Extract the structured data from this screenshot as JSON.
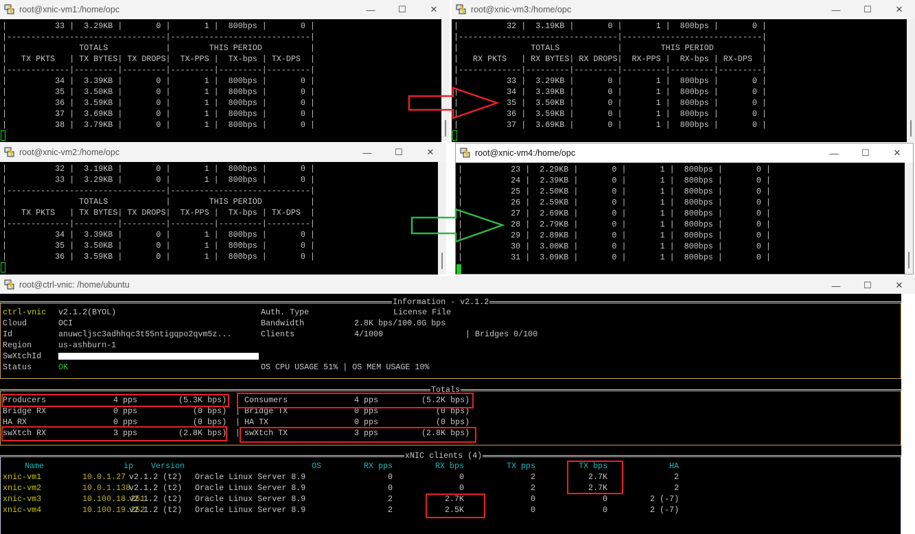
{
  "windows": {
    "vm1": {
      "title": "root@xnic-vm1:/home/opc",
      "prefix": "TX",
      "period_prefix": "TX",
      "top_rows": [
        [
          "33",
          "3.29KB",
          "0",
          "1",
          "800bps",
          "0"
        ]
      ],
      "rows": [
        [
          "34",
          "3.39KB",
          "0",
          "1",
          "800bps",
          "0"
        ],
        [
          "35",
          "3.50KB",
          "0",
          "1",
          "800bps",
          "0"
        ],
        [
          "36",
          "3.59KB",
          "0",
          "1",
          "800bps",
          "0"
        ],
        [
          "37",
          "3.69KB",
          "0",
          "1",
          "800bps",
          "0"
        ],
        [
          "38",
          "3.79KB",
          "0",
          "1",
          "800bps",
          "0"
        ]
      ]
    },
    "vm3": {
      "title": "root@xnic-vm3:/home/opc",
      "prefix": "RX",
      "period_prefix": "RX",
      "top_rows": [
        [
          "32",
          "3.19KB",
          "0",
          "1",
          "800bps",
          "0"
        ]
      ],
      "rows": [
        [
          "33",
          "3.29KB",
          "0",
          "1",
          "800bps",
          "0"
        ],
        [
          "34",
          "3.39KB",
          "0",
          "1",
          "800bps",
          "0"
        ],
        [
          "35",
          "3.50KB",
          "0",
          "1",
          "800bps",
          "0"
        ],
        [
          "36",
          "3.59KB",
          "0",
          "1",
          "800bps",
          "0"
        ],
        [
          "37",
          "3.69KB",
          "0",
          "1",
          "800bps",
          "0"
        ]
      ]
    },
    "vm2": {
      "title": "root@xnic-vm2:/home/opc",
      "prefix": "TX",
      "period_prefix": "TX",
      "top_rows": [
        [
          "32",
          "3.19KB",
          "0",
          "1",
          "800bps",
          "0"
        ],
        [
          "33",
          "3.29KB",
          "0",
          "1",
          "800bps",
          "0"
        ]
      ],
      "rows": [
        [
          "34",
          "3.39KB",
          "0",
          "1",
          "800bps",
          "0"
        ],
        [
          "35",
          "3.50KB",
          "0",
          "1",
          "800bps",
          "0"
        ],
        [
          "36",
          "3.59KB",
          "0",
          "1",
          "800bps",
          "0"
        ]
      ]
    },
    "vm4": {
      "title": "root@xnic-vm4:/home/opc",
      "rows": [
        [
          "23",
          "2.29KB",
          "0",
          "1",
          "800bps",
          "0"
        ],
        [
          "24",
          "2.39KB",
          "0",
          "1",
          "800bps",
          "0"
        ],
        [
          "25",
          "2.50KB",
          "0",
          "1",
          "800bps",
          "0"
        ],
        [
          "26",
          "2.59KB",
          "0",
          "1",
          "800bps",
          "0"
        ],
        [
          "27",
          "2.69KB",
          "0",
          "1",
          "800bps",
          "0"
        ],
        [
          "28",
          "2.79KB",
          "0",
          "1",
          "800bps",
          "0"
        ],
        [
          "29",
          "2.89KB",
          "0",
          "1",
          "800bps",
          "0"
        ],
        [
          "30",
          "3.00KB",
          "0",
          "1",
          "800bps",
          "0"
        ],
        [
          "31",
          "3.09KB",
          "0",
          "1",
          "800bps",
          "0"
        ]
      ]
    },
    "headings": {
      "totals": "TOTALS",
      "period": "THIS PERIOD",
      "pkts": "PKTS",
      "bytes": "BYTES",
      "drops": "DROPS",
      "pps": "-PPS",
      "bps": "-bps",
      "dps": "-DPS"
    }
  },
  "ctrl": {
    "title": "root@ctrl-vnic: /home/ubuntu",
    "info": {
      "box_title": "Information - v2.1.2",
      "product": "ctrl-vnic",
      "version": "v2.1.2(BYOL)",
      "cloud_label": "Cloud",
      "cloud": "OCI",
      "id_label": "Id",
      "id": "anuwcljsc3adhhqc3t55ntigqpo2qvm5z...",
      "region_label": "Region",
      "region": "us-ashburn-1",
      "swxtchid_label": "SwXtchId",
      "status_label": "Status",
      "status": "OK",
      "auth_label": "Auth. Type",
      "auth": "License File",
      "bandwidth_label": "Bandwidth",
      "bandwidth": "2.8K bps/100.0G bps",
      "clients_label": "Clients",
      "clients": "4/1000",
      "bridges": "| Bridges 0/100",
      "usage": "OS CPU USAGE 51% | OS MEM USAGE 10%"
    },
    "totals": {
      "box_title": "Totals",
      "left": [
        {
          "label": "Producers",
          "pps": "4 pps",
          "bps": "(5.3K bps)"
        },
        {
          "label": "Bridge RX",
          "pps": "0 pps",
          "bps": "(0 bps)"
        },
        {
          "label": "HA RX",
          "pps": "0 pps",
          "bps": "(0 bps)"
        },
        {
          "label": "swXtch RX",
          "pps": "3 pps",
          "bps": "(2.8K bps)"
        }
      ],
      "right": [
        {
          "label": "Consumers",
          "pps": "4 pps",
          "bps": "(5.2K bps)"
        },
        {
          "label": "Bridge TX",
          "pps": "0 pps",
          "bps": "(0 bps)"
        },
        {
          "label": "HA TX",
          "pps": "0 pps",
          "bps": "(0 bps)"
        },
        {
          "label": "swXtch TX",
          "pps": "3 pps",
          "bps": "(2.8K bps)"
        }
      ]
    },
    "clients": {
      "box_title": "xNIC clients (4)",
      "headers": [
        "Name",
        "ip",
        "Version",
        "OS",
        "RX pps",
        "RX bps",
        "TX pps",
        "TX bps",
        "HA"
      ],
      "rows": [
        [
          "xnic-vm1",
          "10.0.1.27",
          "v2.1.2 (t2)",
          "Oracle Linux Server 8.9",
          "0",
          "0",
          "2",
          "2.7K",
          "2"
        ],
        [
          "xnic-vm2",
          "10.0.1.138",
          "v2.1.2 (t2)",
          "Oracle Linux Server 8.9",
          "0",
          "0",
          "2",
          "2.7K",
          "2"
        ],
        [
          "xnic-vm3",
          "10.100.18.251",
          "v2.1.2 (t2)",
          "Oracle Linux Server 8.9",
          "2",
          "2.7K",
          "0",
          "0",
          "2 (-7)"
        ],
        [
          "xnic-vm4",
          "10.100.19.252",
          "v2.1.2 (t2)",
          "Oracle Linux Server 8.9",
          "2",
          "2.5K",
          "0",
          "0",
          "2 (-7)"
        ]
      ]
    }
  },
  "colors": {
    "highlight": "#e8202a",
    "arrow_red": "#e8202a",
    "arrow_green": "#2db84a",
    "terminal_bg": "#000000"
  },
  "icons": {
    "window": "putty-icon",
    "minimize": "minimize-icon",
    "maximize": "maximize-icon",
    "close": "close-icon"
  }
}
